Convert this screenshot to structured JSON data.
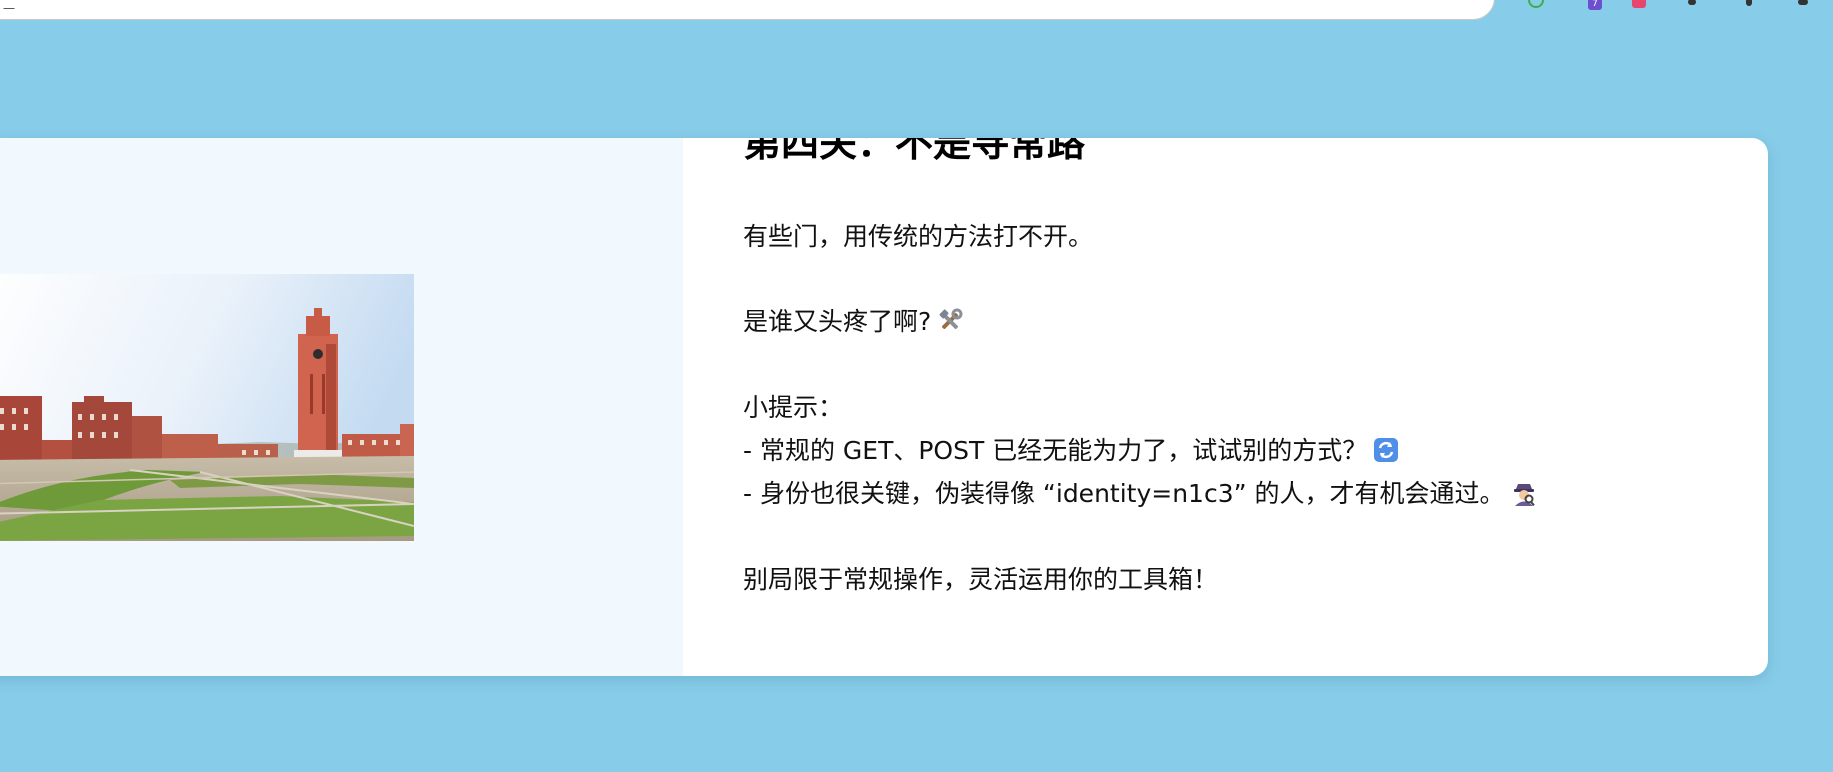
{
  "browser": {
    "address_text": "一",
    "action_icon": "translate-icon",
    "extension_badge": "7"
  },
  "page": {
    "title": "第四关：不是寻常路",
    "intro": "有些门，用传统的方法打不开。",
    "question": "是谁又头疼了啊?",
    "hint_label": "小提示：",
    "hint_1": "- 常规的 GET、POST 已经无能为力了，试试别的方式？",
    "hint_2": "- 身份也很关键，伪装得像 “identity=n1c3” 的人，才有机会通过。",
    "outro": "别局限于常规操作，灵活运用你的工具箱！",
    "icons": {
      "question": "tools-icon",
      "hint_1": "repeat-icon",
      "hint_2": "detective-icon"
    },
    "colors": {
      "page_background": "#87CDE9",
      "left_panel": "#F1F8FE",
      "card": "#FFFFFF"
    }
  }
}
